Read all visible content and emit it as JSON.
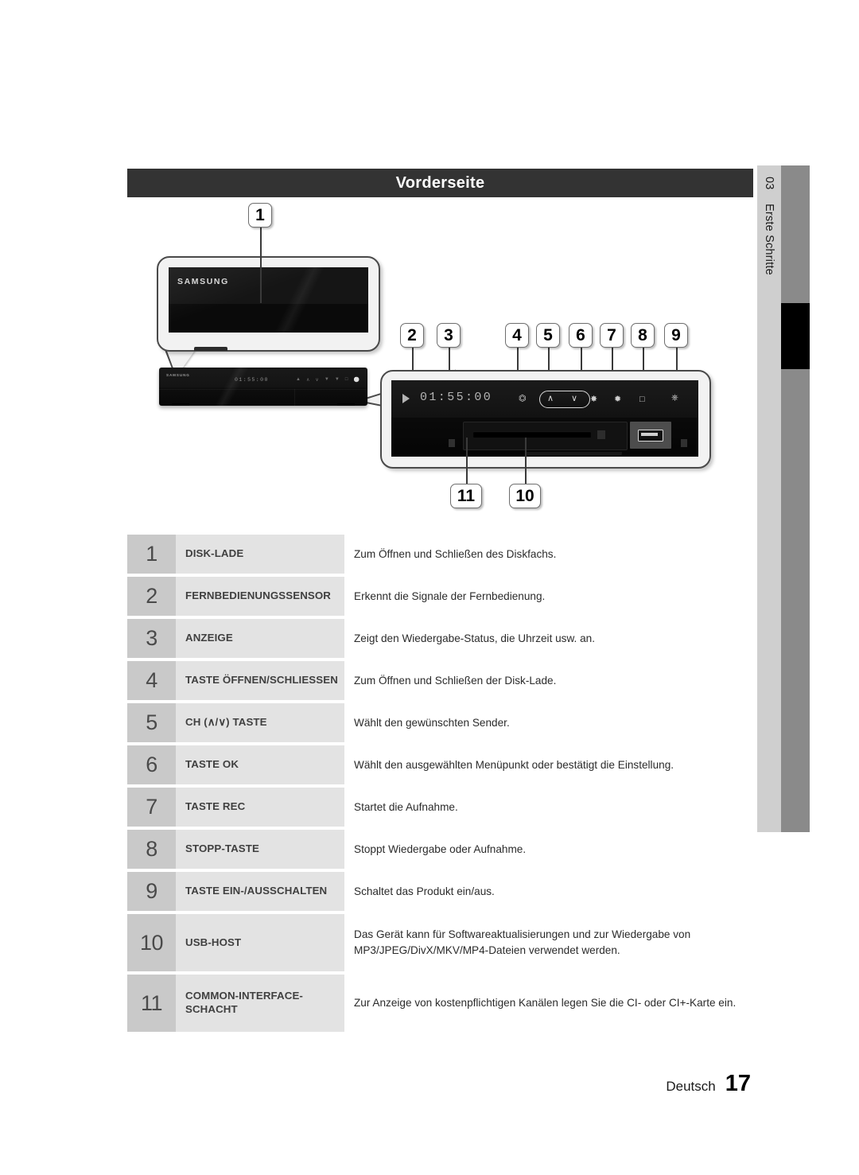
{
  "side_tab": {
    "chapter_number": "03",
    "chapter_label": "Erste Schritte"
  },
  "banner": {
    "title": "Vorderseite"
  },
  "device": {
    "brand": "SAMSUNG",
    "display_time": "01:55:00",
    "display_time_small": "01:55:00",
    "play_icon": "play-icon",
    "eject_icon": "eject-icon",
    "ch_up_icon": "chevron-up-icon",
    "ch_down_icon": "chevron-down-icon",
    "ok_icon": "ok-button-icon",
    "rec_icon": "record-button-icon",
    "stop_icon": "stop-button-icon",
    "power_icon": "power-icon"
  },
  "callouts": [
    {
      "id": "1",
      "number": "1"
    },
    {
      "id": "2",
      "number": "2"
    },
    {
      "id": "3",
      "number": "3"
    },
    {
      "id": "4",
      "number": "4"
    },
    {
      "id": "5",
      "number": "5"
    },
    {
      "id": "6",
      "number": "6"
    },
    {
      "id": "7",
      "number": "7"
    },
    {
      "id": "8",
      "number": "8"
    },
    {
      "id": "9",
      "number": "9"
    },
    {
      "id": "10",
      "number": "10"
    },
    {
      "id": "11",
      "number": "11"
    }
  ],
  "legend": {
    "rows": [
      {
        "number": "1",
        "label": "DISK-LADE",
        "description": "Zum Öffnen und Schließen des Diskfachs."
      },
      {
        "number": "2",
        "label": "FERNBEDIENUNGSSENSOR",
        "description": "Erkennt die Signale der Fernbedienung."
      },
      {
        "number": "3",
        "label": "ANZEIGE",
        "description": "Zeigt den Wiedergabe-Status, die Uhrzeit usw. an."
      },
      {
        "number": "4",
        "label": "TASTE ÖFFNEN/SCHLIESSEN",
        "description": "Zum Öffnen und Schließen der Disk-Lade."
      },
      {
        "number": "5",
        "label": "CH (∧/∨) TASTE",
        "description": "Wählt den gewünschten Sender."
      },
      {
        "number": "6",
        "label": "TASTE OK",
        "description": "Wählt den ausgewählten Menüpunkt oder bestätigt die Einstellung."
      },
      {
        "number": "7",
        "label": "TASTE REC",
        "description": "Startet die Aufnahme."
      },
      {
        "number": "8",
        "label": "STOPP-TASTE",
        "description": "Stoppt Wiedergabe oder Aufnahme."
      },
      {
        "number": "9",
        "label": "TASTE EIN-/AUSSCHALTEN",
        "description": "Schaltet das Produkt ein/aus."
      },
      {
        "number": "10",
        "label": "USB-HOST",
        "description": "Das Gerät kann für Softwareaktualisierungen und zur Wiedergabe von MP3/JPEG/DivX/MKV/MP4-Dateien verwendet werden."
      },
      {
        "number": "11",
        "label": "COMMON-INTERFACE-SCHACHT",
        "description": "Zur Anzeige von kostenpflichtigen Kanälen legen Sie die CI- oder CI+-Karte ein."
      }
    ]
  },
  "footer": {
    "language": "Deutsch",
    "page_number": "17"
  },
  "colors": {
    "banner_bg": "#333333",
    "num_cell_bg": "#c9c9c9",
    "label_cell_bg": "#e3e3e3",
    "side_tab_light": "#cfcfcf",
    "side_tab_dark": "#8a8a8a"
  }
}
